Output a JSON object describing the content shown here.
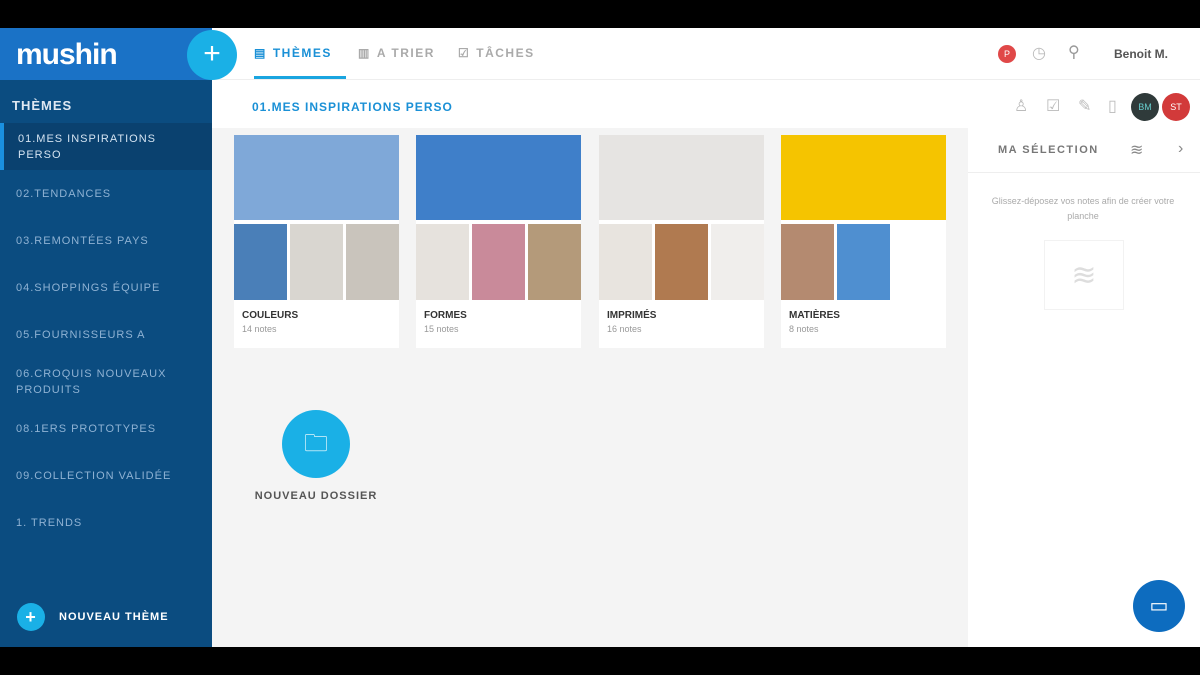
{
  "logo": "mushin",
  "tabs": [
    {
      "label": "THÈMES",
      "icon": "calendar-icon"
    },
    {
      "label": "A TRIER",
      "icon": "inbox-icon"
    },
    {
      "label": "TÂCHES",
      "icon": "edit-icon"
    }
  ],
  "user": {
    "name": "Benoit M."
  },
  "sidebar": {
    "title": "THÈMES",
    "items": [
      "01.MES INSPIRATIONS PERSO",
      "02.TENDANCES",
      "03.REMONTÉES PAYS",
      "04.SHOPPINGS ÉQUIPE",
      "05.FOURNISSEURS A",
      "06.CROQUIS NOUVEAUX PRODUITS",
      "08.1ERS PROTOTYPES",
      "09.COLLECTION VALIDÉE",
      "1. TRENDS"
    ],
    "new_theme": "NOUVEAU THÈME"
  },
  "breadcrumb": "01.MES INSPIRATIONS PERSO",
  "avatars": [
    {
      "initials": "BM",
      "color": "#2f3a3a"
    },
    {
      "initials": "ST",
      "color": "#d23a3a"
    }
  ],
  "folders": [
    {
      "name": "COULEURS",
      "count": "14 notes",
      "colors": [
        "#7fa8d8",
        "#4a7fb8",
        "#d9d6d0",
        "#c9c4bc"
      ]
    },
    {
      "name": "FORMES",
      "count": "15 notes",
      "colors": [
        "#3f7fc9",
        "#e6e2dd",
        "#c98a9a",
        "#b49a7a"
      ]
    },
    {
      "name": "IMPRIMÉS",
      "count": "16 notes",
      "colors": [
        "#e6e4e2",
        "#e8e4df",
        "#b07a50",
        "#f0eeec"
      ]
    },
    {
      "name": "MATIÈRES",
      "count": "8 notes",
      "colors": [
        "#f5c400",
        "#b48a70",
        "#4f8fd0",
        "#ffffff"
      ]
    }
  ],
  "new_folder": "NOUVEAU DOSSIER",
  "selection": {
    "title": "MA SÉLECTION",
    "hint": "Glissez-déposez vos notes afin de créer votre planche"
  }
}
